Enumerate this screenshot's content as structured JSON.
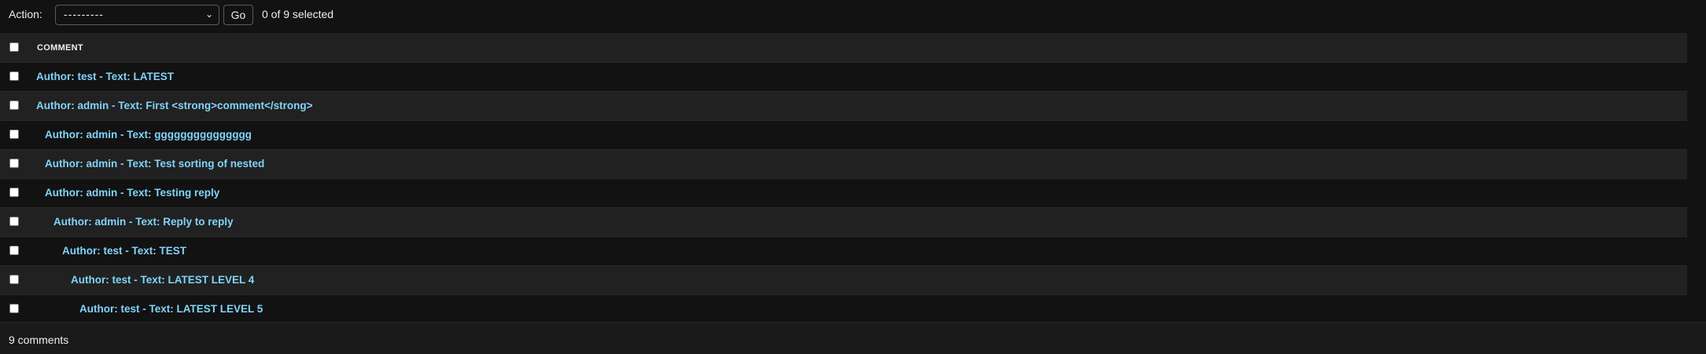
{
  "actions": {
    "label": "Action:",
    "select_value": "---------",
    "go_label": "Go",
    "selected_text": "0 of 9 selected"
  },
  "table": {
    "column_header": "COMMENT",
    "rows": [
      {
        "text": "Author: test - Text: LATEST",
        "level": 0
      },
      {
        "text": "Author: admin - Text: First <strong>comment</strong>",
        "level": 0
      },
      {
        "text": "Author: admin - Text: ggggggggggggggg",
        "level": 1
      },
      {
        "text": "Author: admin - Text: Test sorting of nested",
        "level": 1
      },
      {
        "text": "Author: admin - Text: Testing reply",
        "level": 1
      },
      {
        "text": "Author: admin - Text: Reply to reply",
        "level": 2
      },
      {
        "text": "Author: test - Text: TEST",
        "level": 3
      },
      {
        "text": "Author: test - Text: LATEST LEVEL 4",
        "level": 4
      },
      {
        "text": "Author: test - Text: LATEST LEVEL 5",
        "level": 5
      }
    ]
  },
  "footer": {
    "count_text": "9 comments"
  },
  "colors": {
    "background": "#121212",
    "row_alt": "#212121",
    "link": "#81d4fa",
    "text": "#eeeeee"
  }
}
